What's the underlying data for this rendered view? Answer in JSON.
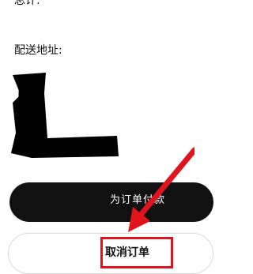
{
  "order": {
    "total_label": "总计:",
    "address_label": "配送地址:"
  },
  "actions": {
    "pay_label": "为订单付款",
    "cancel_label": "取消订单"
  },
  "colors": {
    "pay_button_bg": "#111111",
    "highlight": "#e0141c"
  }
}
